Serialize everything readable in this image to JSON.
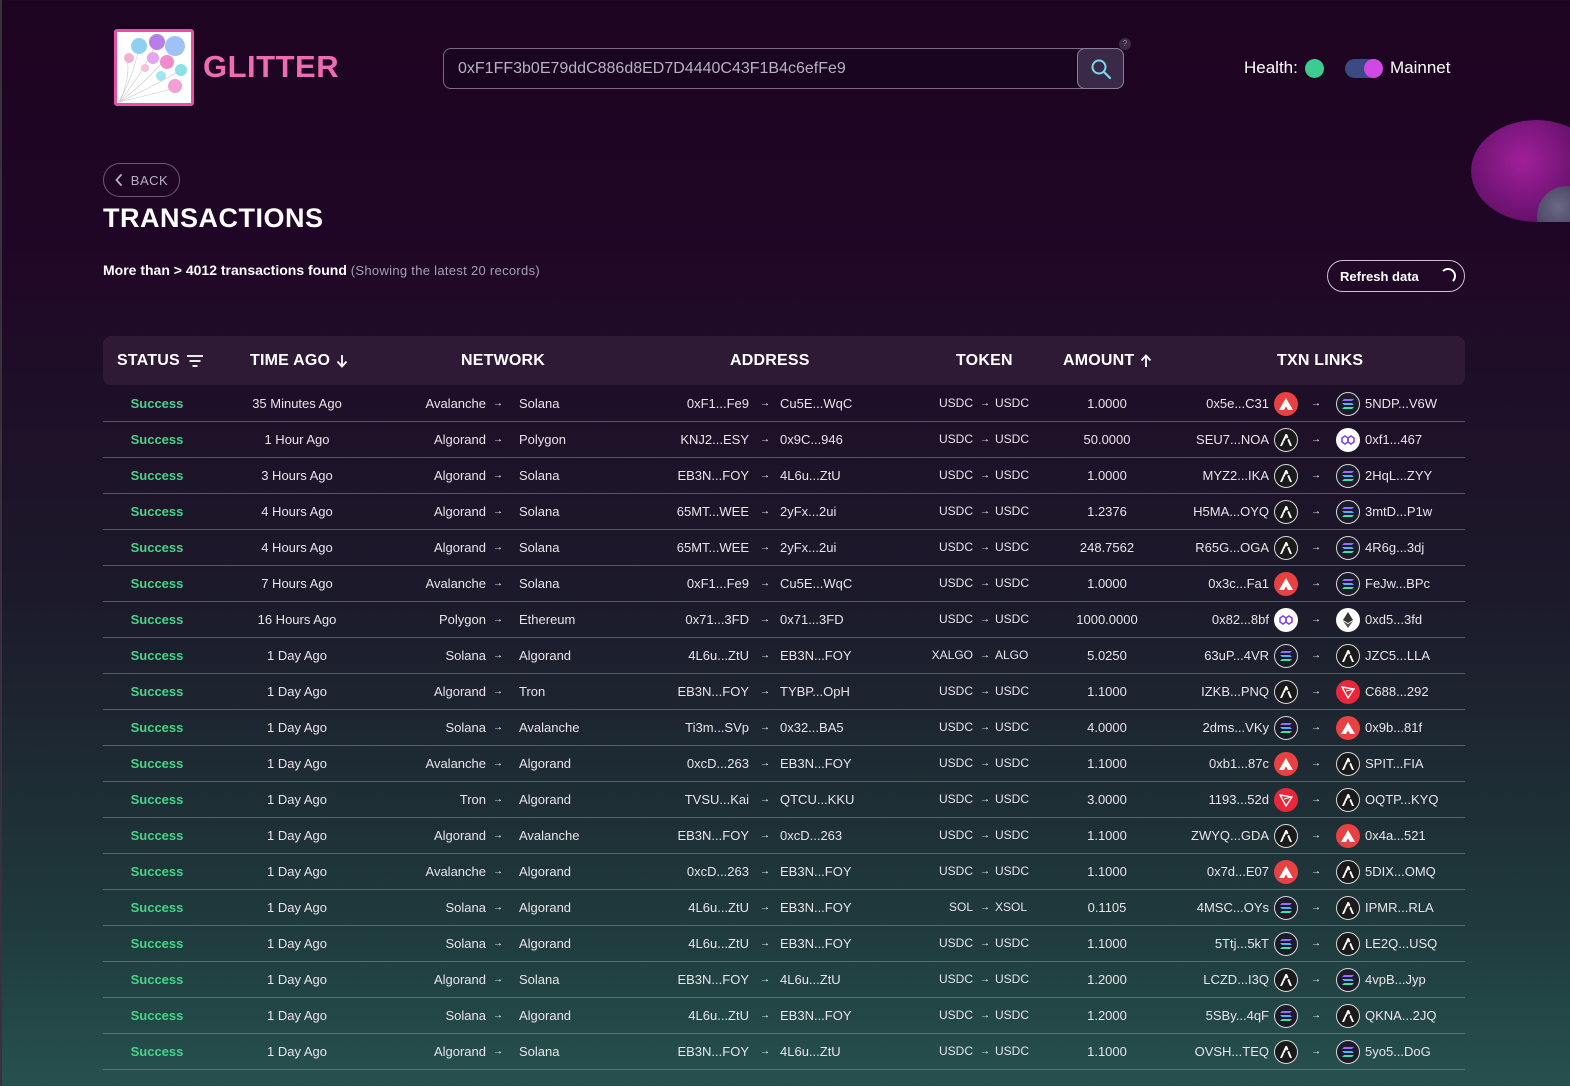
{
  "header": {
    "logo_text": "GLITTER",
    "search_value": "0xF1FF3b0E79ddC886d8ED7D4440C43F1B4c6efFe9",
    "help_badge": "?",
    "health_label": "Health:",
    "network_toggle_label": "Mainnet",
    "colors": {
      "health_ok": "#3ecb8f",
      "brand_pink": "#f06bb6",
      "toggle_knob": "#d148e3"
    }
  },
  "page": {
    "back_label": "BACK",
    "title": "TRANSACTIONS",
    "summary_main": "More than > 4012 transactions found",
    "summary_sub": "(Showing the latest 20 records)",
    "refresh_label": "Refresh data"
  },
  "table": {
    "columns": {
      "status": "STATUS",
      "time_ago": "TIME AGO",
      "network": "NETWORK",
      "address": "ADDRESS",
      "token": "TOKEN",
      "amount": "AMOUNT",
      "txn_links": "TXN LINKS"
    },
    "arrow": "→",
    "rows": [
      {
        "status": "Success",
        "time": "35 Minutes Ago",
        "from_net": "Avalanche",
        "to_net": "Solana",
        "from_addr": "0xF1...Fe9",
        "to_addr": "Cu5E...WqC",
        "from_tok": "USDC",
        "to_tok": "USDC",
        "amount": "1.0000",
        "src_txn": "0x5e...C31",
        "src_icon": "avax",
        "dst_icon": "sol",
        "dst_txn": "5NDP...V6W"
      },
      {
        "status": "Success",
        "time": "1 Hour Ago",
        "from_net": "Algorand",
        "to_net": "Polygon",
        "from_addr": "KNJ2...ESY",
        "to_addr": "0x9C...946",
        "from_tok": "USDC",
        "to_tok": "USDC",
        "amount": "50.0000",
        "src_txn": "SEU7...NOA",
        "src_icon": "algo",
        "dst_icon": "poly",
        "dst_txn": "0xf1...467"
      },
      {
        "status": "Success",
        "time": "3 Hours Ago",
        "from_net": "Algorand",
        "to_net": "Solana",
        "from_addr": "EB3N...FOY",
        "to_addr": "4L6u...ZtU",
        "from_tok": "USDC",
        "to_tok": "USDC",
        "amount": "1.0000",
        "src_txn": "MYZ2...IKA",
        "src_icon": "algo",
        "dst_icon": "sol",
        "dst_txn": "2HqL...ZYY"
      },
      {
        "status": "Success",
        "time": "4 Hours Ago",
        "from_net": "Algorand",
        "to_net": "Solana",
        "from_addr": "65MT...WEE",
        "to_addr": "2yFx...2ui",
        "from_tok": "USDC",
        "to_tok": "USDC",
        "amount": "1.2376",
        "src_txn": "H5MA...OYQ",
        "src_icon": "algo",
        "dst_icon": "sol",
        "dst_txn": "3mtD...P1w"
      },
      {
        "status": "Success",
        "time": "4 Hours Ago",
        "from_net": "Algorand",
        "to_net": "Solana",
        "from_addr": "65MT...WEE",
        "to_addr": "2yFx...2ui",
        "from_tok": "USDC",
        "to_tok": "USDC",
        "amount": "248.7562",
        "src_txn": "R65G...OGA",
        "src_icon": "algo",
        "dst_icon": "sol",
        "dst_txn": "4R6g...3dj"
      },
      {
        "status": "Success",
        "time": "7 Hours Ago",
        "from_net": "Avalanche",
        "to_net": "Solana",
        "from_addr": "0xF1...Fe9",
        "to_addr": "Cu5E...WqC",
        "from_tok": "USDC",
        "to_tok": "USDC",
        "amount": "1.0000",
        "src_txn": "0x3c...Fa1",
        "src_icon": "avax",
        "dst_icon": "sol",
        "dst_txn": "FeJw...BPc"
      },
      {
        "status": "Success",
        "time": "16 Hours Ago",
        "from_net": "Polygon",
        "to_net": "Ethereum",
        "from_addr": "0x71...3FD",
        "to_addr": "0x71...3FD",
        "from_tok": "USDC",
        "to_tok": "USDC",
        "amount": "1000.0000",
        "src_txn": "0x82...8bf",
        "src_icon": "poly",
        "dst_icon": "eth",
        "dst_txn": "0xd5...3fd"
      },
      {
        "status": "Success",
        "time": "1 Day Ago",
        "from_net": "Solana",
        "to_net": "Algorand",
        "from_addr": "4L6u...ZtU",
        "to_addr": "EB3N...FOY",
        "from_tok": "XALGO",
        "to_tok": "ALGO",
        "amount": "5.0250",
        "src_txn": "63uP...4VR",
        "src_icon": "sol",
        "dst_icon": "algo",
        "dst_txn": "JZC5...LLA"
      },
      {
        "status": "Success",
        "time": "1 Day Ago",
        "from_net": "Algorand",
        "to_net": "Tron",
        "from_addr": "EB3N...FOY",
        "to_addr": "TYBP...OpH",
        "from_tok": "USDC",
        "to_tok": "USDC",
        "amount": "1.1000",
        "src_txn": "IZKB...PNQ",
        "src_icon": "algo",
        "dst_icon": "tron",
        "dst_txn": "C688...292"
      },
      {
        "status": "Success",
        "time": "1 Day Ago",
        "from_net": "Solana",
        "to_net": "Avalanche",
        "from_addr": "Ti3m...SVp",
        "to_addr": "0x32...BA5",
        "from_tok": "USDC",
        "to_tok": "USDC",
        "amount": "4.0000",
        "src_txn": "2dms...VKy",
        "src_icon": "sol",
        "dst_icon": "avax",
        "dst_txn": "0x9b...81f"
      },
      {
        "status": "Success",
        "time": "1 Day Ago",
        "from_net": "Avalanche",
        "to_net": "Algorand",
        "from_addr": "0xcD...263",
        "to_addr": "EB3N...FOY",
        "from_tok": "USDC",
        "to_tok": "USDC",
        "amount": "1.1000",
        "src_txn": "0xb1...87c",
        "src_icon": "avax",
        "dst_icon": "algo",
        "dst_txn": "SPIT...FIA"
      },
      {
        "status": "Success",
        "time": "1 Day Ago",
        "from_net": "Tron",
        "to_net": "Algorand",
        "from_addr": "TVSU...Kai",
        "to_addr": "QTCU...KKU",
        "from_tok": "USDC",
        "to_tok": "USDC",
        "amount": "3.0000",
        "src_txn": "1193...52d",
        "src_icon": "tron",
        "dst_icon": "algo",
        "dst_txn": "OQTP...KYQ"
      },
      {
        "status": "Success",
        "time": "1 Day Ago",
        "from_net": "Algorand",
        "to_net": "Avalanche",
        "from_addr": "EB3N...FOY",
        "to_addr": "0xcD...263",
        "from_tok": "USDC",
        "to_tok": "USDC",
        "amount": "1.1000",
        "src_txn": "ZWYQ...GDA",
        "src_icon": "algo",
        "dst_icon": "avax",
        "dst_txn": "0x4a...521"
      },
      {
        "status": "Success",
        "time": "1 Day Ago",
        "from_net": "Avalanche",
        "to_net": "Algorand",
        "from_addr": "0xcD...263",
        "to_addr": "EB3N...FOY",
        "from_tok": "USDC",
        "to_tok": "USDC",
        "amount": "1.1000",
        "src_txn": "0x7d...E07",
        "src_icon": "avax",
        "dst_icon": "algo",
        "dst_txn": "5DIX...OMQ"
      },
      {
        "status": "Success",
        "time": "1 Day Ago",
        "from_net": "Solana",
        "to_net": "Algorand",
        "from_addr": "4L6u...ZtU",
        "to_addr": "EB3N...FOY",
        "from_tok": "SOL",
        "to_tok": "XSOL",
        "amount": "0.1105",
        "src_txn": "4MSC...OYs",
        "src_icon": "sol",
        "dst_icon": "algo",
        "dst_txn": "IPMR...RLA"
      },
      {
        "status": "Success",
        "time": "1 Day Ago",
        "from_net": "Solana",
        "to_net": "Algorand",
        "from_addr": "4L6u...ZtU",
        "to_addr": "EB3N...FOY",
        "from_tok": "USDC",
        "to_tok": "USDC",
        "amount": "1.1000",
        "src_txn": "5Ttj...5kT",
        "src_icon": "sol",
        "dst_icon": "algo",
        "dst_txn": "LE2Q...USQ"
      },
      {
        "status": "Success",
        "time": "1 Day Ago",
        "from_net": "Algorand",
        "to_net": "Solana",
        "from_addr": "EB3N...FOY",
        "to_addr": "4L6u...ZtU",
        "from_tok": "USDC",
        "to_tok": "USDC",
        "amount": "1.2000",
        "src_txn": "LCZD...I3Q",
        "src_icon": "algo",
        "dst_icon": "sol",
        "dst_txn": "4vpB...Jyp"
      },
      {
        "status": "Success",
        "time": "1 Day Ago",
        "from_net": "Solana",
        "to_net": "Algorand",
        "from_addr": "4L6u...ZtU",
        "to_addr": "EB3N...FOY",
        "from_tok": "USDC",
        "to_tok": "USDC",
        "amount": "1.2000",
        "src_txn": "5SBy...4qF",
        "src_icon": "sol",
        "dst_icon": "algo",
        "dst_txn": "QKNA...2JQ"
      },
      {
        "status": "Success",
        "time": "1 Day Ago",
        "from_net": "Algorand",
        "to_net": "Solana",
        "from_addr": "EB3N...FOY",
        "to_addr": "4L6u...ZtU",
        "from_tok": "USDC",
        "to_tok": "USDC",
        "amount": "1.1000",
        "src_txn": "OVSH...TEQ",
        "src_icon": "algo",
        "dst_icon": "sol",
        "dst_txn": "5yo5...DoG"
      }
    ]
  }
}
